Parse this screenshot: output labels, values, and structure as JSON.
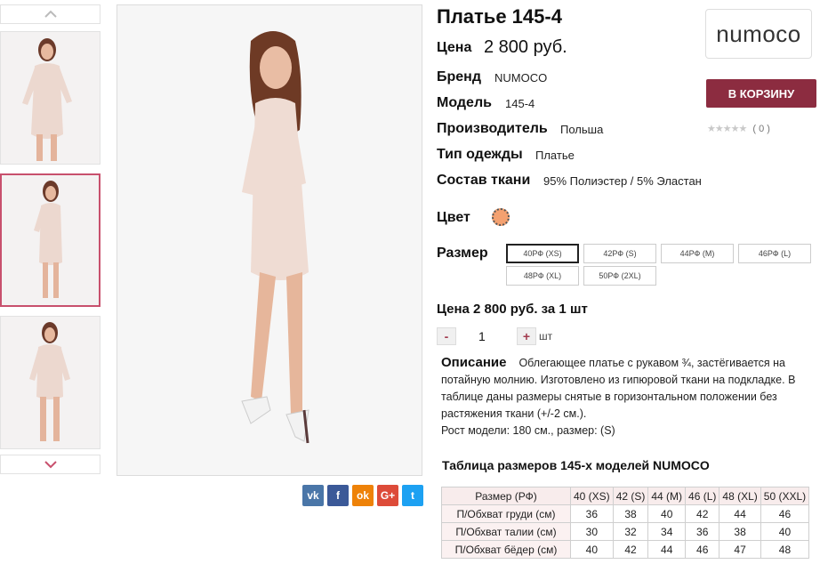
{
  "product": {
    "title": "Платье 145-4",
    "price_label": "Цена",
    "price_value": "2 800 руб.",
    "specs": [
      {
        "label": "Бренд",
        "value": "NUMOCO"
      },
      {
        "label": "Модель",
        "value": "145-4"
      },
      {
        "label": "Производитель",
        "value": "Польша"
      },
      {
        "label": "Тип одежды",
        "value": "Платье"
      },
      {
        "label": "Состав ткани",
        "value": "95% Полиэстер / 5% Эластан"
      }
    ],
    "color_label": "Цвет",
    "color_swatch": "#f4a170",
    "size_label": "Размер",
    "sizes": [
      "40РФ (XS)",
      "42РФ (S)",
      "44РФ (M)",
      "46РФ (L)",
      "48РФ (XL)",
      "50РФ (2XL)"
    ],
    "selected_size": "40РФ (XS)",
    "unit_price_text": "Цена 2 800 руб. за 1 шт",
    "quantity": {
      "minus": "-",
      "value": "1",
      "plus": "+",
      "unit": "шт"
    }
  },
  "brand_logo": {
    "text": "numoco"
  },
  "cart_button": "В КОРЗИНУ",
  "rating": {
    "stars": "★★★★★",
    "count": "( 0 )"
  },
  "description": {
    "label": "Описание",
    "text": "Облегающее платье с рукавом ¾, застёгивается на потайную молнию. Изготовлено из гипюровой ткани на подкладке. В таблице даны размеры снятые в горизонтальном положении без растяжения ткани (+/-2 см.).",
    "model_info": "Рост модели: 180 см., размер: (S)"
  },
  "size_table": {
    "title": "Таблица размеров 145-х моделей NUMOCO",
    "headers": [
      "Размер (РФ)",
      "40 (XS)",
      "42 (S)",
      "44 (M)",
      "46 (L)",
      "48 (XL)",
      "50 (XXL)"
    ],
    "rows": [
      [
        "П/Обхват груди (см)",
        "36",
        "38",
        "40",
        "42",
        "44",
        "46"
      ],
      [
        "П/Обхват талии (см)",
        "30",
        "32",
        "34",
        "36",
        "38",
        "40"
      ],
      [
        "П/Обхват бёдер (см)",
        "40",
        "42",
        "44",
        "46",
        "47",
        "48"
      ]
    ]
  },
  "social": [
    {
      "name": "vk",
      "glyph": "vk",
      "color": "#4a76a8"
    },
    {
      "name": "facebook",
      "glyph": "f",
      "color": "#3b5998"
    },
    {
      "name": "odnoklassniki",
      "glyph": "ok",
      "color": "#ee8208"
    },
    {
      "name": "google-plus",
      "glyph": "G+",
      "color": "#dd4b39"
    },
    {
      "name": "twitter",
      "glyph": "t",
      "color": "#1da1f2"
    }
  ],
  "colors": {
    "accent": "#8c2c40",
    "thumb_active": "#c8506d",
    "nav_arrow": "#c8506d"
  }
}
